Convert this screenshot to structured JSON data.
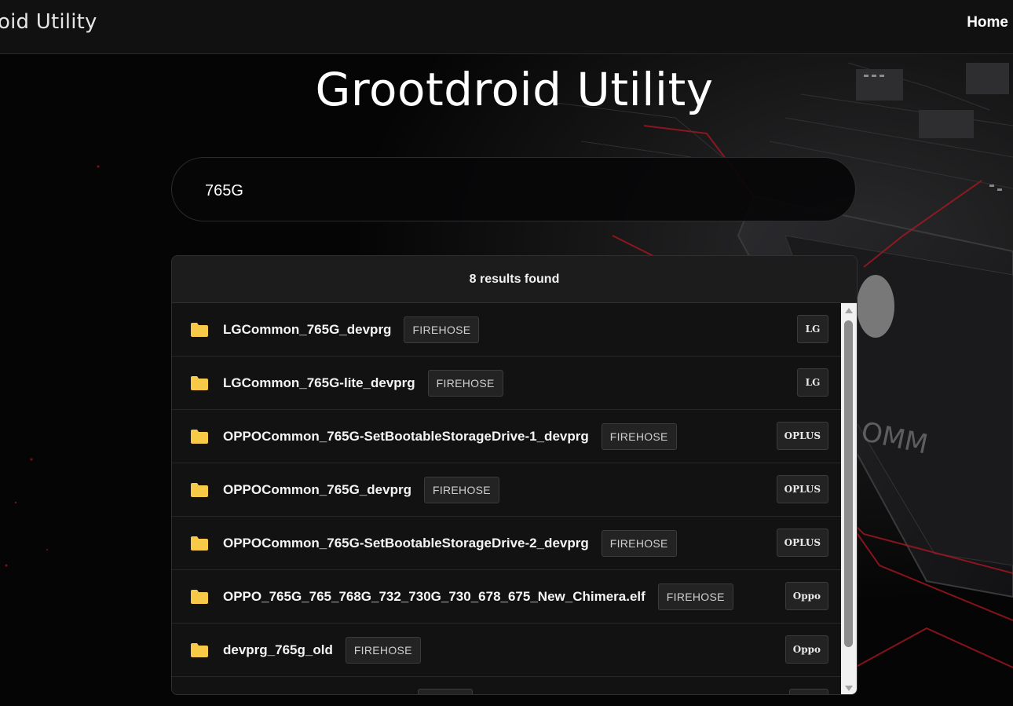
{
  "navbar": {
    "brand": "droid Utility",
    "home_label": "Home"
  },
  "hero": {
    "title": "Grootdroid Utility"
  },
  "search": {
    "value": "765G"
  },
  "results": {
    "count_label": "8 results found",
    "items": [
      {
        "name": "LGCommon_765G_devprg",
        "tag": "FIREHOSE",
        "brand": "LG"
      },
      {
        "name": "LGCommon_765G-lite_devprg",
        "tag": "FIREHOSE",
        "brand": "LG"
      },
      {
        "name": "OPPOCommon_765G-SetBootableStorageDrive-1_devprg",
        "tag": "FIREHOSE",
        "brand": "OPLUS"
      },
      {
        "name": "OPPOCommon_765G_devprg",
        "tag": "FIREHOSE",
        "brand": "OPLUS"
      },
      {
        "name": "OPPOCommon_765G-SetBootableStorageDrive-2_devprg",
        "tag": "FIREHOSE",
        "brand": "OPLUS"
      },
      {
        "name": "OPPO_765G_765_768G_732_730G_730_678_675_New_Chimera.elf",
        "tag": "FIREHOSE",
        "brand": "Oppo"
      },
      {
        "name": "devprg_765g_old",
        "tag": "FIREHOSE",
        "brand": "Oppo"
      }
    ]
  },
  "colors": {
    "folder_icon": "#f7c948",
    "accent_red": "#b01722",
    "panel_bg": "#121212"
  },
  "icons": {
    "folder": "folder-icon"
  }
}
